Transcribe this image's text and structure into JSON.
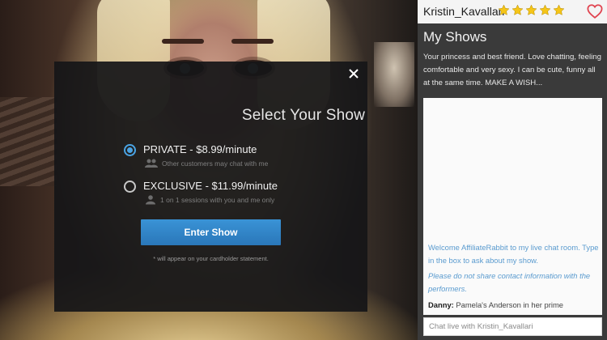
{
  "modal": {
    "title": "Select Your Show",
    "options": [
      {
        "label": "PRIVATE - $8.99/minute",
        "description": "Other customers may chat with me",
        "selected": true,
        "icon": "users-icon"
      },
      {
        "label": "EXCLUSIVE - $11.99/minute",
        "description": "1 on 1 sessions with you and me only",
        "selected": false,
        "icon": "user-icon"
      }
    ],
    "enter_button": "Enter Show",
    "footnote": "* will appear on your cardholder statement."
  },
  "profile": {
    "username": "Kristin_Kavallari",
    "rating": 5,
    "rating_color": "#f5c518",
    "favorite_icon": "heart-icon",
    "favorite_color": "#e0434f"
  },
  "shows": {
    "title": "My Shows",
    "description": "Your princess and best friend. Love chatting, feeling comfortable and very sexy. I can be cute, funny all at the same time. MAKE A WISH..."
  },
  "chat": {
    "welcome": "Welcome AffiliateRabbit to my live chat room. Type in the box to ask about my show.",
    "privacy_notice": "Please do not share contact information with the performers.",
    "messages": [
      {
        "sender": "Danny:",
        "text": "Pamela's Anderson in her prime"
      }
    ],
    "input_placeholder": "Chat live with Kristin_Kavallari"
  },
  "colors": {
    "accent": "#4aa3e3",
    "button": "#2f82c5",
    "panel_bg": "#3a3a3a"
  }
}
